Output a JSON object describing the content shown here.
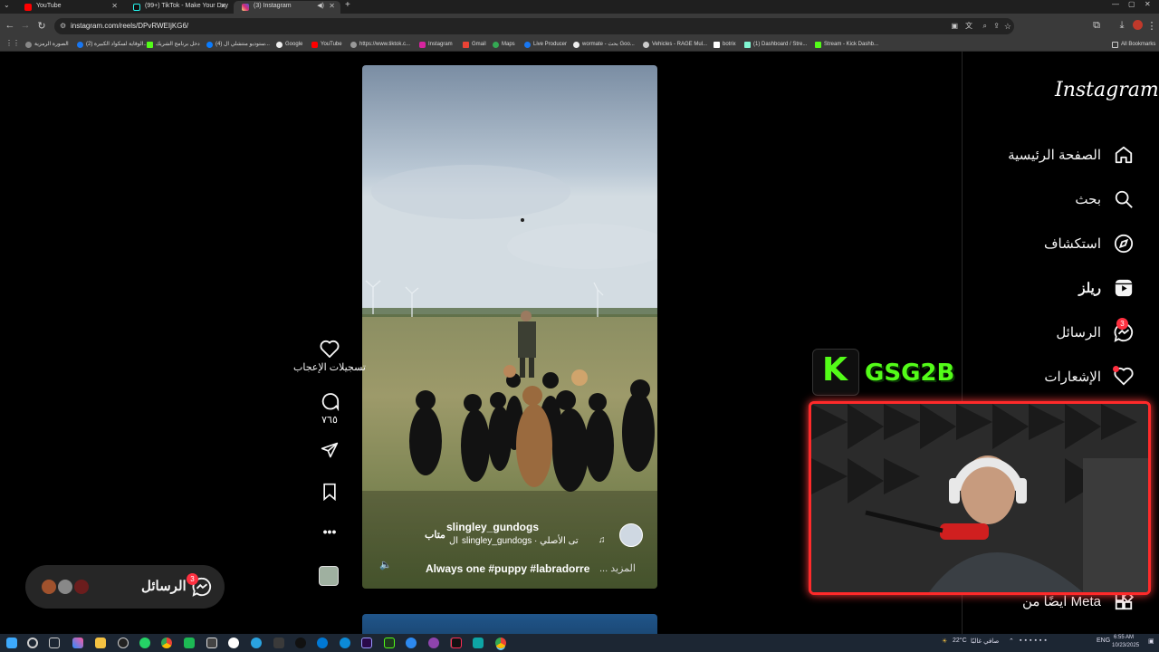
{
  "browser": {
    "tabs": [
      {
        "label": "YouTube",
        "color": "#ff0000"
      },
      {
        "label": "(99+) TikTok - Make Your Day",
        "color": "#111111"
      },
      {
        "label": "(3) Instagram",
        "color": "#d6249f"
      }
    ],
    "new_tab": "+",
    "url": "instagram.com/reels/DPvRWEIjKG6/",
    "bookmarks": [
      "الصورة الرمزية",
      "(2) الوقاية لسكواد الكبيرة...",
      "دخل برنامج الشريك",
      "(4) ستوديو منتشلي ال...",
      "Google",
      "YouTube",
      "https://www.tiktok.c...",
      "Instagram",
      "Gmail",
      "Maps",
      "Live Producer",
      "wormate - بحث Goo...",
      "Vehicles - RAGE Mul...",
      "botrix",
      "(1) Dashboard / Stre...",
      "Stream - Kick Dashb..."
    ],
    "all_bookmarks": "All Bookmarks"
  },
  "instagram": {
    "logo": "Instagram",
    "nav": [
      {
        "label": "الصفحة الرئيسية",
        "icon": "home-icon"
      },
      {
        "label": "بحث",
        "icon": "search-icon"
      },
      {
        "label": "استكشاف",
        "icon": "explore-icon"
      },
      {
        "label": "ريلز",
        "icon": "reels-icon"
      },
      {
        "label": "الرسائل",
        "icon": "messenger-icon",
        "badge": "3"
      },
      {
        "label": "الإشعارات",
        "icon": "heart-icon"
      },
      {
        "label": "ايضًا من Meta",
        "icon": "apps-icon"
      }
    ],
    "reel": {
      "username": "slingley_gundogs",
      "follow": "متاب",
      "audio": "slingley_gundogs · تى الأصلي",
      "audio_prefix": "ال",
      "caption": "Always one #puppy #labradorre",
      "more": "... المزيد"
    },
    "actions": {
      "likes_label": "تسجيلات الإعجاب",
      "comments_count": "٧٦٥"
    },
    "messages_pill": {
      "label": "الرسائل",
      "badge": "3"
    }
  },
  "stream": {
    "kick_channel": "GSG2B",
    "kick_letter": "K"
  },
  "taskbar": {
    "weather": "22°C",
    "weather_desc": "صافي غالبًا",
    "lang": "ENG",
    "time": "6:55 AM",
    "date": "10/23/2025"
  },
  "colors": {
    "accent_red": "#ff3040",
    "kick_green": "#53fc18",
    "webcam_border": "#ff2a2a"
  }
}
